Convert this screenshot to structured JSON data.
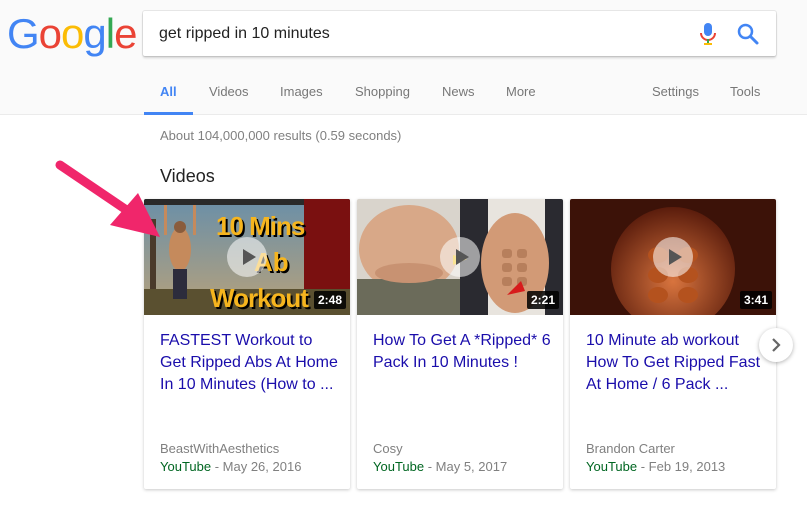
{
  "logo": {
    "letters": [
      "G",
      "o",
      "o",
      "g",
      "l",
      "e"
    ],
    "colors": [
      "#4285F4",
      "#EA4335",
      "#FBBC05",
      "#4285F4",
      "#34A853",
      "#EA4335"
    ]
  },
  "search": {
    "query": "get ripped in 10 minutes",
    "mic_icon": "microphone-icon",
    "search_icon": "search-icon"
  },
  "tabs": [
    {
      "label": "All",
      "active": true
    },
    {
      "label": "Videos"
    },
    {
      "label": "Images"
    },
    {
      "label": "Shopping"
    },
    {
      "label": "News"
    },
    {
      "label": "More"
    },
    {
      "label": "Settings"
    },
    {
      "label": "Tools"
    }
  ],
  "results_count": "About 104,000,000 results (0.59 seconds)",
  "videos": {
    "section_title": "Videos",
    "items": [
      {
        "title": "FASTEST Workout to Get Ripped Abs At Home In 10 Minutes (How to ...",
        "duration": "2:48",
        "channel": "BeastWithAesthetics",
        "source": "YouTube",
        "date": "- May 26, 2016",
        "thumb_text": [
          "10 Mins",
          "Ab",
          "Workout"
        ]
      },
      {
        "title": "How To Get A *Ripped* 6 Pack In 10 Minutes !",
        "duration": "2:21",
        "channel": "Cosy",
        "source": "YouTube",
        "date": "- May 5, 2017"
      },
      {
        "title": "10 Minute ab workout How To Get Ripped Fast At Home / 6 Pack ...",
        "duration": "3:41",
        "channel": "Brandon Carter",
        "source": "YouTube",
        "date": "- Feb 19, 2013"
      }
    ]
  },
  "accent_colors": {
    "link": "#1a0dab",
    "source": "#006621",
    "tab_active": "#4285f4",
    "annotation_arrow": "#f0266b"
  }
}
